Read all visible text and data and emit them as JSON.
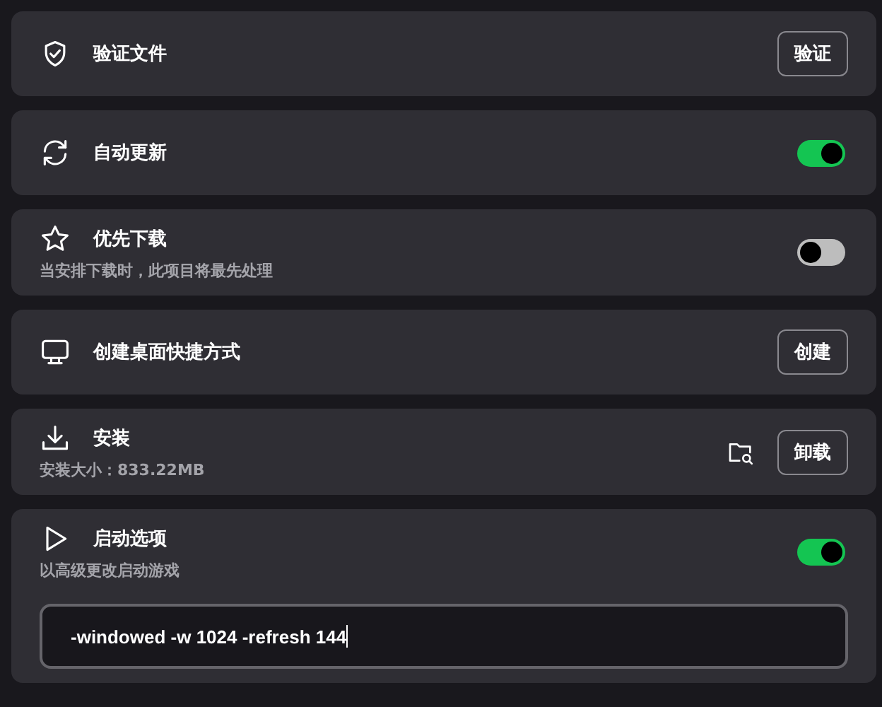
{
  "rows": [
    {
      "kind": "button",
      "title": "验证文件",
      "button": "验证"
    },
    {
      "kind": "toggle",
      "title": "自动更新",
      "on": true
    },
    {
      "kind": "toggle",
      "title": "优先下载",
      "subtitle": "当安排下载时，此项目将最先处理",
      "on": false
    },
    {
      "kind": "button",
      "title": "创建桌面快捷方式",
      "button": "创建"
    },
    {
      "kind": "install",
      "title": "安装",
      "subtitle": "安装大小：833.22MB",
      "button": "卸载"
    },
    {
      "kind": "launch",
      "title": "启动选项",
      "subtitle": "以高级更改启动游戏",
      "on": true,
      "value": "-windowed -w 1024 -refresh 144"
    }
  ]
}
